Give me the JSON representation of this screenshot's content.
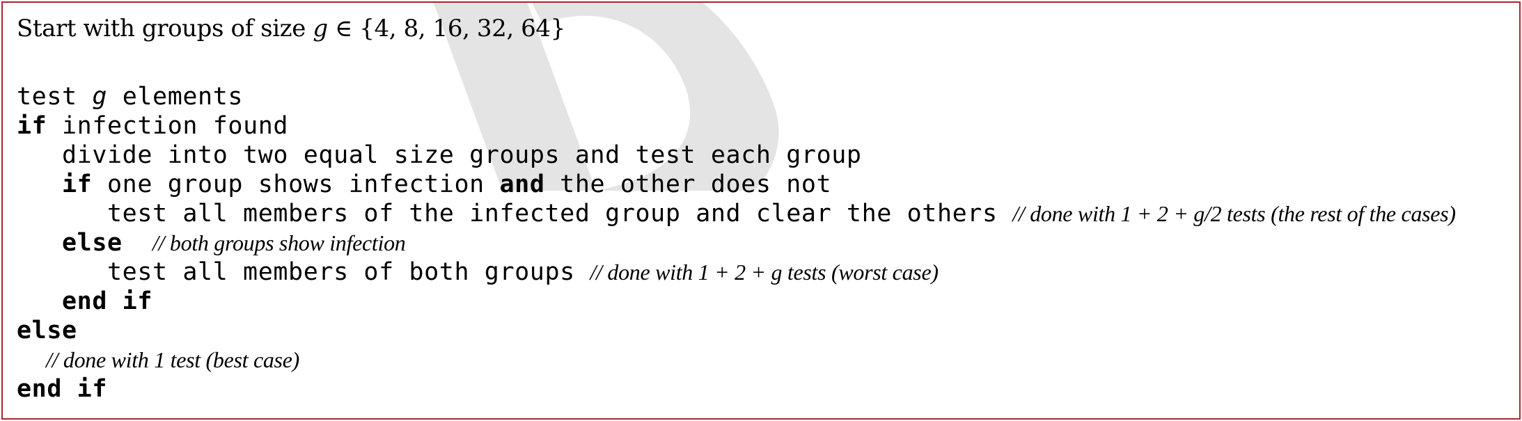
{
  "intro": {
    "prefix": "Start with groups of size ",
    "variable": "g",
    "suffix": " ∈ {4, 8, 16, 32, 64}"
  },
  "code": {
    "line1": {
      "keyword": "test ",
      "variable": "g",
      "text": " elements"
    },
    "line2": {
      "keyword": "if",
      "text": " infection found"
    },
    "line3": {
      "text": "divide into two equal size groups and test each group"
    },
    "line4": {
      "keyword": "if",
      "text_a": " one group shows infection ",
      "keyword_and": "and",
      "text_b": " the other does not"
    },
    "line5": {
      "text": "test all members of the infected group and clear the others ",
      "comment": "// done with 1 + 2 + g/2 tests (the rest of the cases)"
    },
    "line6": {
      "keyword": "else",
      "comment": "// both groups show infection"
    },
    "line7": {
      "text": "test all members of both groups ",
      "comment": "// done with 1 + 2 + g tests (worst case)"
    },
    "line8": {
      "keyword": "end if"
    },
    "line9": {
      "keyword": "else"
    },
    "line10": {
      "comment": "// done with 1 test (best case)"
    },
    "line11": {
      "keyword": "end if"
    }
  },
  "watermark": {
    "color": "#e4e4e4"
  },
  "colors": {
    "border": "#a8262b",
    "text": "#000000"
  }
}
